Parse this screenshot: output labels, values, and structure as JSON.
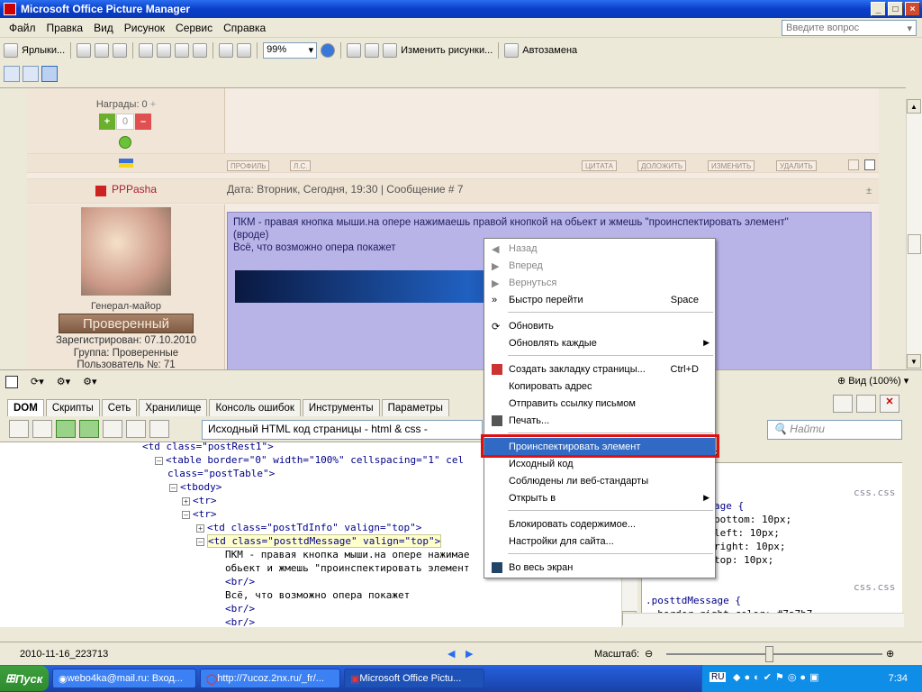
{
  "window": {
    "title": "Microsoft Office Picture Manager",
    "min": "_",
    "max": "□",
    "close": "×"
  },
  "menu": [
    "Файл",
    "Правка",
    "Вид",
    "Рисунок",
    "Сервис",
    "Справка"
  ],
  "ask_box": "Введите вопрос",
  "toolbar": {
    "shortcuts": "Ярлыки...",
    "zoom": "99%",
    "edit_pictures": "Изменить рисунки...",
    "autocorrect": "Автозамена"
  },
  "forum": {
    "awards": "Награды: 0",
    "counter": "0",
    "btns_left": [
      "ПРОФИЛЬ",
      "Л.С."
    ],
    "btns_right": [
      "ЦИТАТА",
      "ДОЛОЖИТЬ",
      "ИЗМЕНИТЬ",
      "УДАЛИТЬ"
    ],
    "nick": "PPPasha",
    "date": "Дата: Вторник, Сегодня, 19:30 | Сообщение # 7",
    "plusminus": "±",
    "rank": "Генерал-майор",
    "rank_badge": "Проверенный",
    "registered": "Зарегистрирован: 07.10.2010",
    "group": "Группа: Проверенные",
    "user_no": "Пользователь №: 71",
    "message_line1": "ПКМ - правая кнопка мыши.на опере нажимаешь правой кнопкой на обьект и жмешь \"проинспектировать элемент\" (вроде)",
    "message_line2": "Всё, что возможно опера покажет"
  },
  "devtools": {
    "tabs": [
      "DOM",
      "Скрипты",
      "Сеть",
      "Хранилище",
      "Консоль ошибок",
      "Инструменты",
      "Параметры"
    ],
    "source_select": "Исходный HTML код страницы - html & css -",
    "find_placeholder": "Найти",
    "view_zoom": "Вид (100%)",
    "styles_header": "ННЫЙ СТИЛЬ",
    "css_file1": "css.css",
    "css_file2": "css.css",
    "css_lines": [
      "age {",
      "bottom: 10px;",
      "left: 10px;",
      "right: 10px;",
      "top: 10px;"
    ],
    "css_selector": ".posttdMessage {",
    "css_partial": "  border-right-color: #7a7b7"
  },
  "tree": [
    {
      "indent": 160,
      "text": "<td class=\"postRest1\">"
    },
    {
      "indent": 174,
      "text": "<table border=\"0\" width=\"100%\" cellspacing=\"1\" cel"
    },
    {
      "indent": 186,
      "text": "class=\"postTable\">"
    },
    {
      "indent": 188,
      "text": "<tbody>"
    },
    {
      "indent": 202,
      "text": "<tr>"
    },
    {
      "indent": 202,
      "text": "<tr>"
    },
    {
      "indent": 218,
      "text": "<td class=\"postTdInfo\" valign=\"top\">"
    },
    {
      "indent": 218,
      "text": "<td class=\"posttdMessage\" valign=\"top\">"
    },
    {
      "indent": 250,
      "text": "ПКМ - правая кнопка мыши.на опере нажимае"
    },
    {
      "indent": 250,
      "text": "обьект и жмешь \"проинспектировать элемент"
    },
    {
      "indent": 250,
      "text": "<br/>"
    },
    {
      "indent": 250,
      "text": "Всё, что возможно опера покажет"
    },
    {
      "indent": 250,
      "text": "<br/>"
    },
    {
      "indent": 250,
      "text": "<br/>"
    }
  ],
  "context_menu": {
    "back": "Назад",
    "forward": "Вперед",
    "return": "Вернуться",
    "quick_go": "Быстро перейти",
    "quick_go_sc": "Space",
    "refresh": "Обновить",
    "refresh_every": "Обновлять каждые",
    "bookmark": "Создать закладку страницы...",
    "bookmark_sc": "Ctrl+D",
    "copy_addr": "Копировать адрес",
    "send_link": "Отправить ссылку письмом",
    "print": "Печать...",
    "inspect": "Проинспектировать элемент",
    "source": "Исходный код",
    "validate": "Соблюдены ли веб-стандарты",
    "open_in": "Открыть в",
    "block": "Блокировать содержимое...",
    "site_prefs": "Настройки для сайта...",
    "fullscreen": "Во весь экран"
  },
  "status": {
    "filename": "2010-11-16_223713",
    "scale_label": "Масштаб:"
  },
  "taskbar": {
    "start": "Пуск",
    "tasks": [
      "webo4ka@mail.ru: Вход...",
      "http://7ucoz.2nx.ru/_fr/...",
      "Microsoft Office Pictu..."
    ],
    "lang": "RU",
    "clock": "7:34"
  }
}
